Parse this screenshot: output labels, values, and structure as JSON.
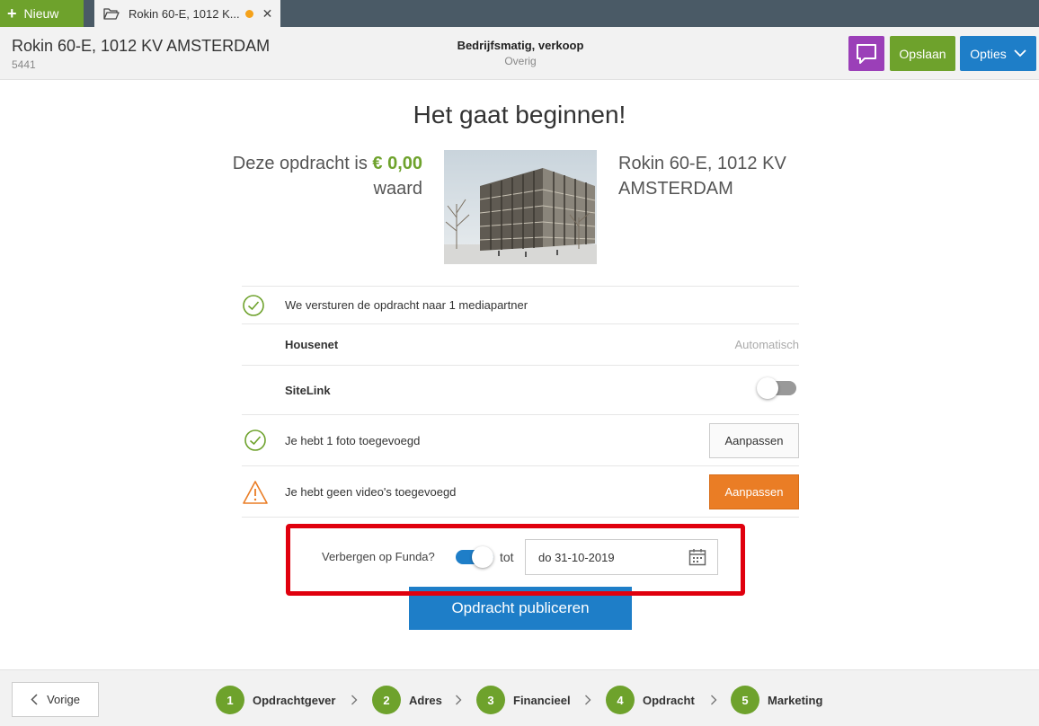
{
  "tabbar": {
    "new_label": "Nieuw",
    "tab_title": "Rokin 60-E, 1012 K...",
    "colors": {
      "new_bg": "#6ea22c",
      "bar_bg": "#4a5a66",
      "unsaved_dot": "#f5a21a"
    }
  },
  "header": {
    "title": "Rokin 60-E, 1012 KV AMSTERDAM",
    "id": "5441",
    "type": "Bedrijfsmatig, verkoop",
    "subtype": "Overig",
    "save_label": "Opslaan",
    "options_label": "Opties",
    "colors": {
      "chat": "#9b3fb8",
      "save": "#6ea22c",
      "options": "#1e7ec8"
    }
  },
  "main": {
    "heading": "Het gaat beginnen!",
    "value_prefix": "Deze opdracht is",
    "value_amount": "€ 0,00",
    "value_suffix": "waard",
    "address_line1": "Rokin 60-E, 1012 KV",
    "address_line2": "AMSTERDAM",
    "media_text": "We versturen de opdracht naar 1 mediapartner",
    "partners": [
      {
        "name": "Housenet",
        "status": "Automatisch"
      },
      {
        "name": "SiteLink",
        "toggle_on": false
      }
    ],
    "photo_text": "Je hebt 1 foto toegevoegd",
    "photo_button": "Aanpassen",
    "video_text": "Je hebt geen video's toegevoegd",
    "video_button": "Aanpassen",
    "funda_label": "Verbergen op Funda?",
    "funda_toggle_on": true,
    "tot_label": "tot",
    "date_value": "do 31-10-2019",
    "publish_label": "Opdracht publiceren",
    "colors": {
      "accent_green": "#6ea22c",
      "warning_orange": "#ea7d25",
      "highlight_red": "#e0000e",
      "primary_blue": "#1e7ec8"
    }
  },
  "footer": {
    "prev_label": "Vorige",
    "steps": [
      {
        "num": "1",
        "label": "Opdrachtgever"
      },
      {
        "num": "2",
        "label": "Adres"
      },
      {
        "num": "3",
        "label": "Financieel"
      },
      {
        "num": "4",
        "label": "Opdracht"
      },
      {
        "num": "5",
        "label": "Marketing"
      }
    ]
  }
}
